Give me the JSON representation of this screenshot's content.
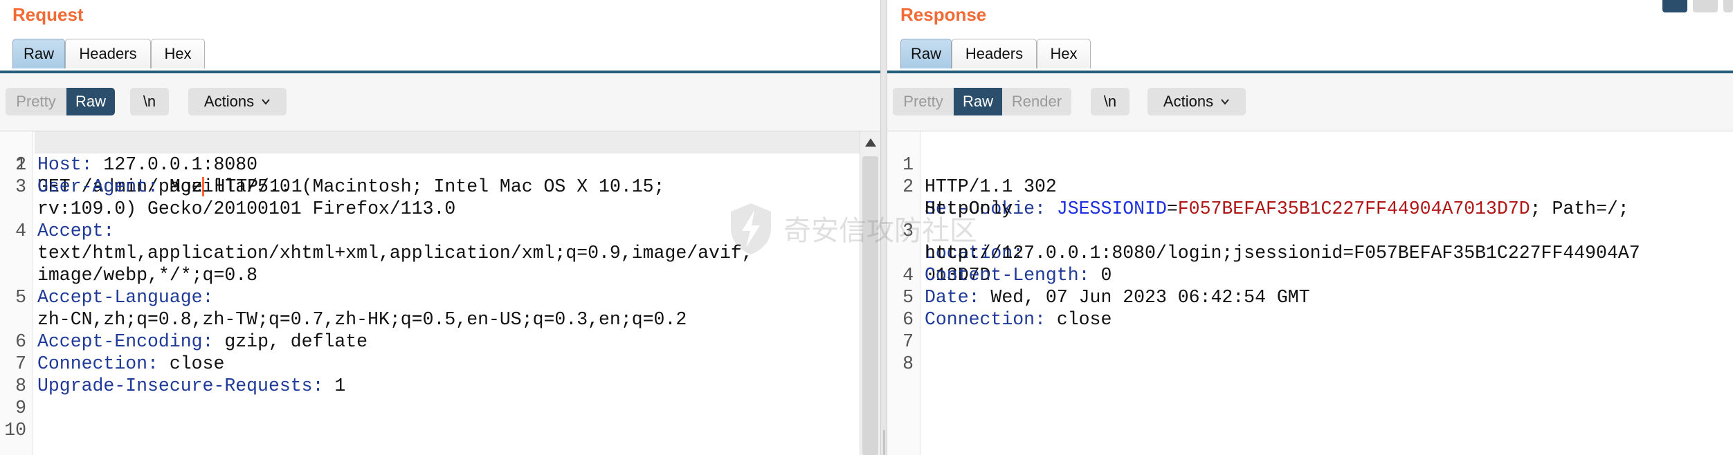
{
  "colors": {
    "title": "#f26a34",
    "header_key": "#1f3a98",
    "cookie_name": "#1c2ee0",
    "cookie_value": "#b01515",
    "active_seg": "#2c4e6d"
  },
  "request": {
    "title": "Request",
    "tabs": [
      {
        "label": "Raw",
        "active": true
      },
      {
        "label": "Headers",
        "active": false
      },
      {
        "label": "Hex",
        "active": false
      }
    ],
    "view_options": [
      {
        "label": "Pretty",
        "active": false
      },
      {
        "label": "Raw",
        "active": true
      }
    ],
    "newline_toggle": "\\n",
    "actions_label": "Actions",
    "lines": [
      {
        "num": "1",
        "key": "",
        "value": "GET /admin/page HTTP/1.1"
      },
      {
        "num": "2",
        "key": "Host:",
        "value": " 127.0.0.1:8080"
      },
      {
        "num": "3",
        "key": "User-Agent:",
        "value": " Mozilla/5.0 (Macintosh; Intel Mac OS X 10.15;"
      },
      {
        "num": "",
        "key": "",
        "value": "rv:109.0) Gecko/20100101 Firefox/113.0"
      },
      {
        "num": "4",
        "key": "Accept:",
        "value": ""
      },
      {
        "num": "",
        "key": "",
        "value": "text/html,application/xhtml+xml,application/xml;q=0.9,image/avif,"
      },
      {
        "num": "",
        "key": "",
        "value": "image/webp,*/*;q=0.8"
      },
      {
        "num": "5",
        "key": "Accept-Language:",
        "value": ""
      },
      {
        "num": "",
        "key": "",
        "value": "zh-CN,zh;q=0.8,zh-TW;q=0.7,zh-HK;q=0.5,en-US;q=0.3,en;q=0.2"
      },
      {
        "num": "6",
        "key": "Accept-Encoding:",
        "value": " gzip, deflate"
      },
      {
        "num": "7",
        "key": "Connection:",
        "value": " close"
      },
      {
        "num": "8",
        "key": "Upgrade-Insecure-Requests:",
        "value": " 1"
      },
      {
        "num": "9",
        "key": "",
        "value": ""
      },
      {
        "num": "10",
        "key": "",
        "value": ""
      }
    ]
  },
  "response": {
    "title": "Response",
    "tabs": [
      {
        "label": "Raw",
        "active": true
      },
      {
        "label": "Headers",
        "active": false
      },
      {
        "label": "Hex",
        "active": false
      }
    ],
    "view_options": [
      {
        "label": "Pretty",
        "active": false
      },
      {
        "label": "Raw",
        "active": true
      },
      {
        "label": "Render",
        "active": false
      }
    ],
    "newline_toggle": "\\n",
    "actions_label": "Actions",
    "status_line": "HTTP/1.1 302",
    "set_cookie": {
      "key": "Set-Cookie:",
      "name": "JSESSIONID",
      "eq": "=",
      "value": "F057BEFAF35B1C227FF44904A7013D7D",
      "rest": "; Path=/;",
      "cont": "HttpOnly"
    },
    "location": {
      "key": "Location:",
      "value": "http://127.0.0.1:8080/login;jsessionid=F057BEFAF35B1C227FF44904A7",
      "cont": "013D7D"
    },
    "lines_after": [
      {
        "num": "4",
        "key": "Content-Length:",
        "value": " 0"
      },
      {
        "num": "5",
        "key": "Date:",
        "value": " Wed, 07 Jun 2023 06:42:54 GMT"
      },
      {
        "num": "6",
        "key": "Connection:",
        "value": " close"
      },
      {
        "num": "7",
        "key": "",
        "value": ""
      },
      {
        "num": "8",
        "key": "",
        "value": ""
      }
    ]
  },
  "watermark_text": "奇安信攻防社区"
}
